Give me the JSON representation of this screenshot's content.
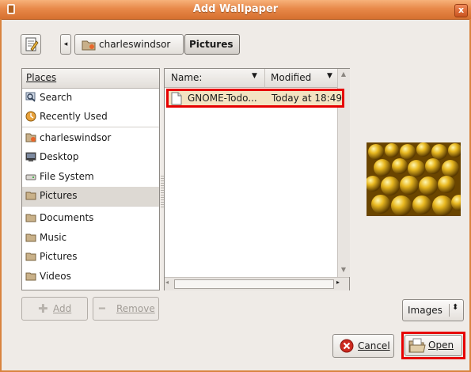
{
  "window": {
    "title": "Add Wallpaper",
    "close_glyph": "x"
  },
  "path_bar": {
    "home_label": "charleswindsor",
    "current_label": "Pictures"
  },
  "places": {
    "header": "Places",
    "items": [
      {
        "label": "Search",
        "icon": "search-icon"
      },
      {
        "label": "Recently Used",
        "icon": "recent-icon"
      },
      {
        "label": "charleswindsor",
        "icon": "home-folder-icon"
      },
      {
        "label": "Desktop",
        "icon": "desktop-icon"
      },
      {
        "label": "File System",
        "icon": "drive-icon"
      },
      {
        "label": "Pictures",
        "icon": "folder-icon",
        "selected": true
      },
      {
        "label": "Documents",
        "icon": "folder-icon"
      },
      {
        "label": "Music",
        "icon": "folder-icon"
      },
      {
        "label": "Pictures",
        "icon": "folder-icon"
      },
      {
        "label": "Videos",
        "icon": "folder-icon"
      }
    ]
  },
  "files": {
    "columns": [
      "Name:",
      "Modified"
    ],
    "rows": [
      {
        "name": "GNOME-Todo...",
        "modified": "Today at 18:49"
      }
    ]
  },
  "buttons": {
    "add": "Add",
    "remove": "Remove",
    "cancel": "Cancel",
    "open": "Open"
  },
  "filter": {
    "selected": "Images"
  },
  "colors": {
    "titlebar": "#e8894a",
    "highlight": "#e60000",
    "selection": "#f3e3c2"
  }
}
